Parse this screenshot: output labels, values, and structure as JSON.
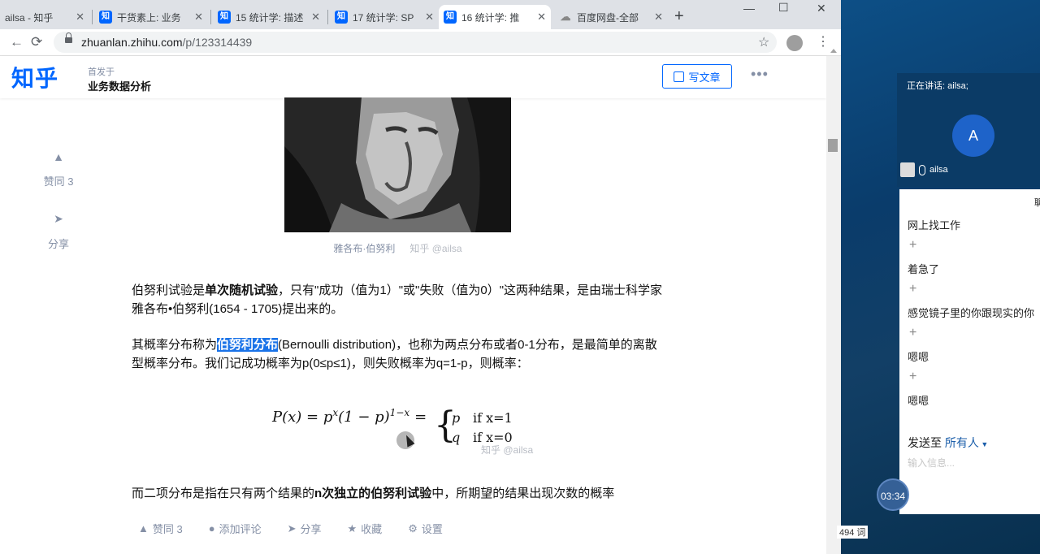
{
  "browser": {
    "tabs": [
      {
        "label": "ailsa - 知乎",
        "favicon": ""
      },
      {
        "label": "干货素上: 业务",
        "favicon": "知"
      },
      {
        "label": "15 统计学: 描述",
        "favicon": "知"
      },
      {
        "label": "17 统计学: SP",
        "favicon": "知"
      },
      {
        "label": "16 统计学: 推",
        "favicon": "知"
      },
      {
        "label": "百度网盘-全部",
        "favicon": "cloud-icon"
      }
    ],
    "url_host": "zhuanlan.zhihu.com",
    "url_path": "/p/123314439"
  },
  "header": {
    "logo": "知乎",
    "published_in_label": "首发于",
    "column_name": "业务数据分析",
    "write_button": "写文章"
  },
  "side_actions": {
    "upvote": "赞同 3",
    "share": "分享"
  },
  "article": {
    "image_caption": "雅各布·伯努利",
    "watermark": "知乎 @ailsa",
    "p1_pre": "伯努利试验是",
    "p1_bold": "单次随机试验",
    "p1_post": "，只有\"成功（值为1）\"或\"失败（值为0）\"这两种结果，是由瑞士科学家雅各布•伯努利(1654 - 1705)提出来的。",
    "p2_pre": "其概率分布称为",
    "p2_highlight": "伯努利分布",
    "p2_post": "(Bernoulli distribution)，也称为两点分布或者0-1分布，是最简单的离散型概率分布。我们记成功概率为p(0≤p≤1)，则失败概率为q=1-p，则概率：",
    "formula_lhs": "P(x) = p",
    "formula_exp1": "x",
    "formula_mid": "(1 − p)",
    "formula_exp2": "1−x",
    "formula_eq": "=",
    "case1_val": "p",
    "case1_cond": "if x=1",
    "case2_val": "q",
    "case2_cond": "if x=0",
    "p3_pre": "而二项分布是指在只有两个结果的",
    "p3_bold": "n次独立的伯努利试验",
    "p3_post": "中，所期望的结果出现次数的概率"
  },
  "footer_actions": {
    "upvote": "赞同 3",
    "comment": "添加评论",
    "share": "分享",
    "favorite": "收藏",
    "settings": "设置"
  },
  "word_count": "494 词",
  "meeting": {
    "speaking": "正在讲话: ailsa;",
    "avatar_letter": "A",
    "user_name": "ailsa"
  },
  "chat": {
    "messages": [
      "网上找工作",
      "着急了",
      "感觉镜子里的你跟现实的你",
      "嗯嗯",
      "嗯嗯"
    ],
    "send_to_label": "发送至",
    "send_to_target": "所有人",
    "input_placeholder": "输入信息...",
    "corner_label": "聊"
  },
  "timer": "03:34",
  "colors": {
    "zhihu_blue": "#0066ff",
    "highlight": "#1a73e8",
    "meeting_bg": "#0b3b66"
  }
}
